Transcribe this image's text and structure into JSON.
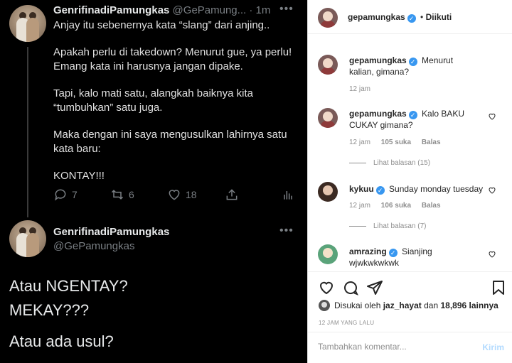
{
  "twitter": {
    "tweet1": {
      "name": "GenrifinadiPamungkas",
      "handle": "@GePamungkas",
      "handle_short": "@GePamung...",
      "separator": "·",
      "time": "1m",
      "more_icon": "more-horizontal-icon",
      "lines": [
        "Anjay itu sebenernya kata “slang” dari anjing..",
        "Apakah perlu di takedown? Menurut gue, ya perlu! Emang kata ini harusnya jangan dipake.",
        "Tapi, kalo mati satu, alangkah baiknya kita “tumbuhkan” satu juga.",
        "Maka dengan ini saya mengusulkan lahirnya satu kata baru:",
        "KONTAY!!!"
      ],
      "actions": {
        "reply_count": "7",
        "retweet_count": "6",
        "like_count": "18"
      }
    },
    "tweet2": {
      "name": "GenrifinadiPamungkas",
      "handle": "@GePamungkas",
      "lines": [
        "Atau NGENTAY?",
        "MEKAY???",
        "Atau ada usul?"
      ]
    }
  },
  "instagram": {
    "header": {
      "username": "gepamungkas",
      "separator": "•",
      "follow_status": "Diikuti"
    },
    "caption": {
      "username": "gepamungkas",
      "text": "Menurut kalian, gimana?",
      "time": "12 jam"
    },
    "comments": [
      {
        "username": "gepamungkas",
        "text": "Kalo BAKU CUKAY gimana?",
        "time": "12 jam",
        "likes": "105 suka",
        "reply_label": "Balas",
        "view_replies": "Lihat balasan (15)"
      },
      {
        "username": "kykuu",
        "text": "Sunday monday tuesday",
        "time": "12 jam",
        "likes": "106 suka",
        "reply_label": "Balas",
        "view_replies": "Lihat balasan (7)"
      },
      {
        "username": "amrazing",
        "text": "Sianjing wjwkwkwkwk"
      }
    ],
    "liked_by": {
      "prefix": "Disukai oleh",
      "user": "jaz_hayat",
      "middle": "dan",
      "count": "18,896 lainnya"
    },
    "time_ago": "12 JAM YANG LALU",
    "comment_box": {
      "placeholder": "Tambahkan komentar...",
      "post_label": "Kirim"
    },
    "colors": {
      "verified": "#3897f0",
      "post_disabled": "#b3dbff"
    }
  }
}
